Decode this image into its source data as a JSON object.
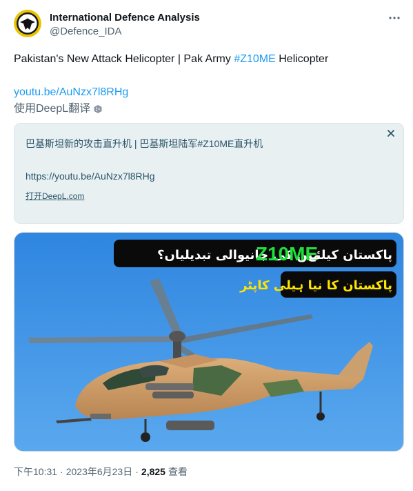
{
  "author": {
    "name": "International Defence Analysis",
    "handle": "@Defence_IDA"
  },
  "tweet": {
    "text_before": "Pakistan's New Attack Helicopter | Pak Army ",
    "hashtag": "#Z10ME",
    "text_after": " Helicopter",
    "link": "youtu.be/AuNzx7l8RHg",
    "translate_label": "使用DeepL翻译"
  },
  "translation": {
    "text": "巴基斯坦新的攻击直升机 | 巴基斯坦陆军#Z10ME直升机",
    "link": "https://youtu.be/AuNzx7l8RHg",
    "open_deepl": "打开DeepL.com"
  },
  "media": {
    "banner_urdu_left": "پاکستان کیلئے",
    "banner_code": "Z10ME",
    "banner_urdu_right": "میں کی جانیوالی تبدیلیاں؟",
    "banner2_urdu": "پاکستان کا نیا ہیلی کاپٹر"
  },
  "meta": {
    "time": "下午10:31",
    "sep1": "·",
    "date": "2023年6月23日",
    "sep2": "·",
    "views": "2,825",
    "views_label": "查看"
  },
  "colors": {
    "accent": "#1d9bf0",
    "translation_bg": "#e8f0f2",
    "banner_green": "#1fe03a"
  }
}
